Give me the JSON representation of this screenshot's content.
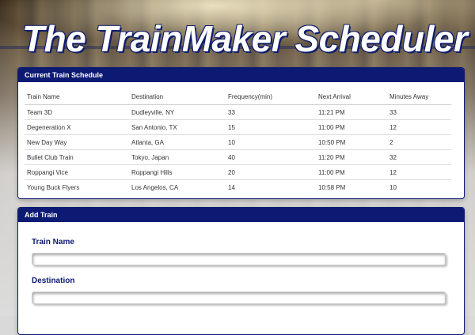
{
  "header": {
    "title": "The TrainMaker Scheduler"
  },
  "schedule": {
    "heading": "Current Train Schedule",
    "columns": [
      "Train Name",
      "Destination",
      "Frequency(min)",
      "Next Arrival",
      "Minutes Away"
    ],
    "rows": [
      [
        "Team 3D",
        "Dudleyville, NY",
        "33",
        "11:21 PM",
        "33"
      ],
      [
        "Degeneration X",
        "San Antonio, TX",
        "15",
        "11:00 PM",
        "12"
      ],
      [
        "New Day Way",
        "Atlanta, GA",
        "10",
        "10:50 PM",
        "2"
      ],
      [
        "Bullet Club Train",
        "Tokyo, Japan",
        "40",
        "11:20 PM",
        "32"
      ],
      [
        "Roppangi Vice",
        "Roppangi Hills",
        "20",
        "11:00 PM",
        "12"
      ],
      [
        "Young Buck Flyers",
        "Los Angelos, CA",
        "14",
        "10:58 PM",
        "10"
      ]
    ]
  },
  "add_train": {
    "heading": "Add Train",
    "train_name_label": "Train Name",
    "train_name_value": "",
    "destination_label": "Destination",
    "destination_value": ""
  },
  "colors": {
    "navy": "#0c1a73",
    "panel_bg": "#ffffff"
  }
}
